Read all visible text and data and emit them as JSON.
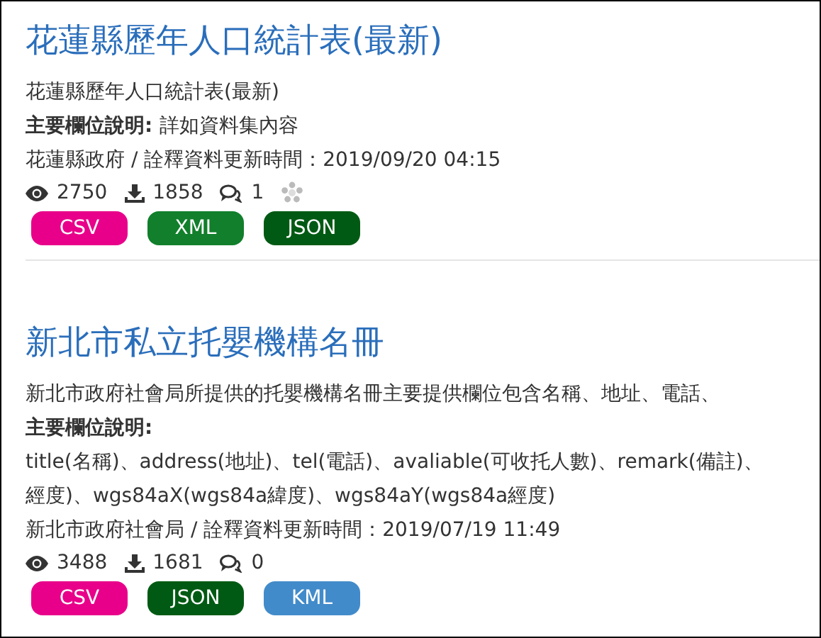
{
  "datasets": [
    {
      "title": "花蓮縣歷年人口統計表(最新)",
      "description": [
        "花蓮縣歷年人口統計表(最新)"
      ],
      "fields_label": "主要欄位說明:",
      "fields_inline": "詳如資料集內容",
      "meta": "花蓮縣政府 / 詮釋資料更新時間：2019/09/20 04:15",
      "views": "2750",
      "downloads": "1858",
      "comments": "1",
      "loading": true,
      "formats": [
        {
          "label": "CSV",
          "color": "#e8008a"
        },
        {
          "label": "XML",
          "color": "#117f2b"
        },
        {
          "label": "JSON",
          "color": "#005a13"
        }
      ]
    },
    {
      "title": "新北市私立托嬰機構名冊",
      "description": [
        "新北市政府社會局所提供的托嬰機構名冊主要提供欄位包含名稱、地址、電話、"
      ],
      "fields_label": "主要欄位說明:",
      "fields_lines": [
        "title(名稱)、address(地址)、tel(電話)、avaliable(可收托人數)、remark(備註)、",
        "經度)、wgs84aX(wgs84a緯度)、wgs84aY(wgs84a經度)"
      ],
      "meta": "新北市政府社會局 / 詮釋資料更新時間：2019/07/19 11:49",
      "views": "3488",
      "downloads": "1681",
      "comments": "0",
      "loading": false,
      "formats": [
        {
          "label": "CSV",
          "color": "#e8008a"
        },
        {
          "label": "JSON",
          "color": "#005a13"
        },
        {
          "label": "KML",
          "color": "#428bca"
        }
      ]
    }
  ]
}
